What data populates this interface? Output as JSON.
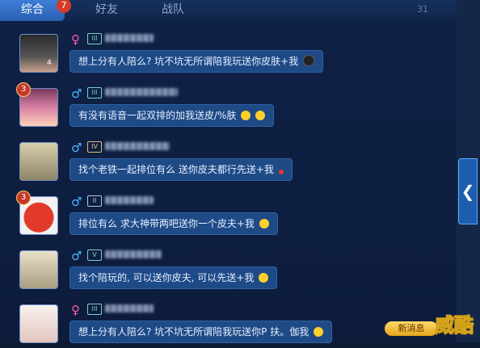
{
  "tabs": [
    {
      "label": "综合"
    },
    {
      "label": "好友"
    },
    {
      "label": "战队"
    }
  ],
  "tab_badge": "7",
  "corner_number": "31",
  "messages": [
    {
      "gender": "♀",
      "level": "",
      "avatar_num": "4",
      "text": "想上分有人陪么? 坑不坑无所谓陪我玩送你皮肤+我"
    },
    {
      "gender": "♂",
      "level": "3",
      "avatar_num": "",
      "text": "有没有语音一起双排的加我送皮/%肤"
    },
    {
      "gender": "♂",
      "level": "",
      "avatar_num": "",
      "text": "找个老铁一起排位有么 送你皮夫都行先送+我"
    },
    {
      "gender": "♂",
      "level": "3",
      "avatar_num": "",
      "text": "排位有么 求大神带两吧送你一个皮夫+我"
    },
    {
      "gender": "♂",
      "level": "",
      "avatar_num": "",
      "text": "找个陪玩的, 可以送你皮夫, 可以先送+我"
    },
    {
      "gender": "♀",
      "level": "",
      "avatar_num": "",
      "text": "想上分有人陪么? 坑不坑无所谓陪我玩送你P 扶。伽我"
    }
  ],
  "new_message_label": "新消息",
  "watermark_text": "威酷",
  "side_arrow": "❮"
}
